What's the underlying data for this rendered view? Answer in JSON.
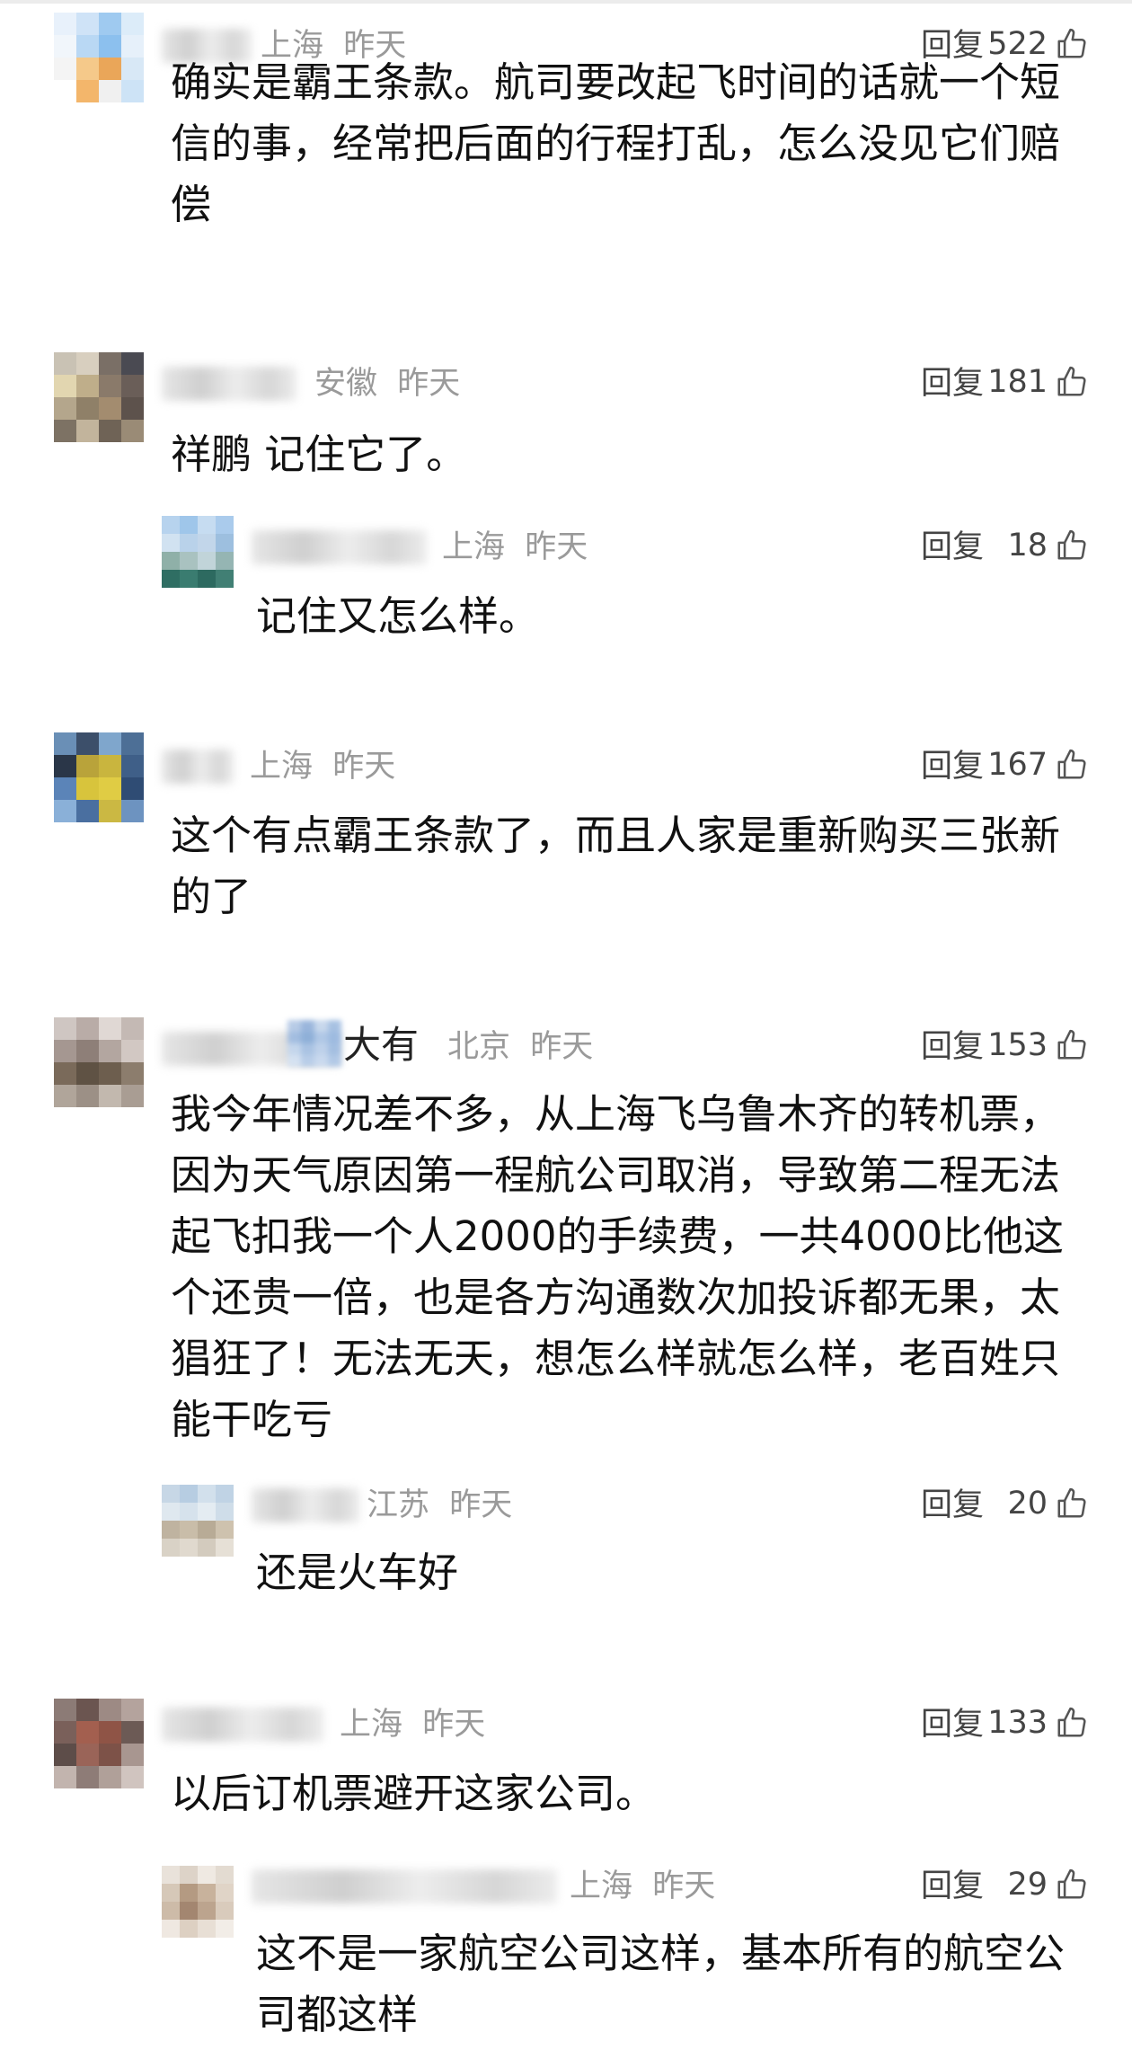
{
  "comments": [
    {
      "location": "上海",
      "time": "昨天",
      "reply_label": "回复",
      "likes": "522",
      "text": "确实是霸王条款。航司要改起飞时间的话就一个短信的事，经常把后面的行程打乱，怎么没见它们赔偿"
    },
    {
      "location": "安徽",
      "time": "昨天",
      "reply_label": "回复",
      "likes": "181",
      "text": "祥鹏 记住它了。"
    },
    {
      "location": "上海",
      "time": "昨天",
      "reply_label": "回复",
      "likes": "18",
      "text": "记住又怎么样。"
    },
    {
      "location": "上海",
      "time": "昨天",
      "reply_label": "回复",
      "likes": "167",
      "text": "这个有点霸王条款了，而且人家是重新购买三张新的了"
    },
    {
      "name_suffix": "大有",
      "location": "北京",
      "time": "昨天",
      "reply_label": "回复",
      "likes": "153",
      "text": "我今年情况差不多，从上海飞乌鲁木齐的转机票，因为天气原因第一程航公司取消，导致第二程无法起飞扣我一个人2000的手续费，一共4000比他这个还贵一倍，也是各方沟通数次加投诉都无果，太猖狂了！无法无天，想怎么样就怎么样，老百姓只能干吃亏"
    },
    {
      "location": "江苏",
      "time": "昨天",
      "reply_label": "回复",
      "likes": "20",
      "text": "还是火车好"
    },
    {
      "location": "上海",
      "time": "昨天",
      "reply_label": "回复",
      "likes": "133",
      "text": "以后订机票避开这家公司。"
    },
    {
      "location": "上海",
      "time": "昨天",
      "reply_label": "回复",
      "likes": "29",
      "text": "这不是一家航空公司这样，基本所有的航空公司都这样"
    }
  ],
  "icons": {
    "like": "thumbs-up-icon"
  },
  "colors": {
    "meta": "#9a9a9a",
    "text": "#111111",
    "background": "#ffffff"
  }
}
